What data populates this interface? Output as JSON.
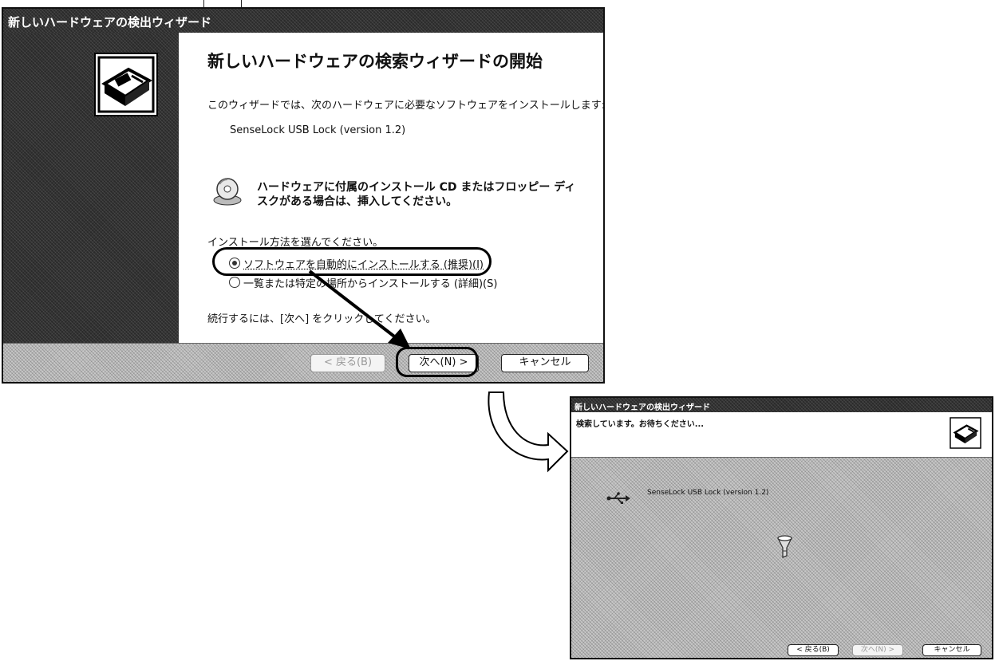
{
  "dialog1": {
    "title": "新しいハードウェアの検出ウィザード",
    "heading": "新しいハードウェアの検索ウィザードの開始",
    "intro": "このウィザードでは、次のハードウェアに必要なソフトウェアをインストールします:",
    "device": "SenseLock USB Lock (version 1.2)",
    "cd_hint_line1": "ハードウェアに付属のインストール CD またはフロッピー ディ",
    "cd_hint_line2": "スクがある場合は、挿入してください。",
    "choose_prompt": "インストール方法を選んでください。",
    "options": [
      {
        "label": "ソフトウェアを自動的にインストールする (推奨)(I)",
        "selected": true
      },
      {
        "label": "一覧または特定の場所からインストールする (詳細)(S)",
        "selected": false
      }
    ],
    "continue_hint": "続行するには、[次へ] をクリックしてください。",
    "buttons": {
      "back": "< 戻る(B)",
      "next": "次へ(N) >",
      "cancel": "キャンセル"
    }
  },
  "dialog2": {
    "title": "新しいハードウェアの検出ウィザード",
    "status": "検索しています。お待ちください...",
    "device": "SenseLock USB Lock (version 1.2)",
    "buttons": {
      "back": "< 戻る(B)",
      "next": "次へ(N) >",
      "cancel": "キャンセル"
    }
  },
  "colors": {
    "title_bar": "#3a3a3a",
    "highlight_outline": "#000000"
  },
  "icons": [
    "hardware-wizard-icon",
    "cd-icon",
    "usb-icon",
    "search-flashlight-icon",
    "transition-arrow-icon"
  ]
}
